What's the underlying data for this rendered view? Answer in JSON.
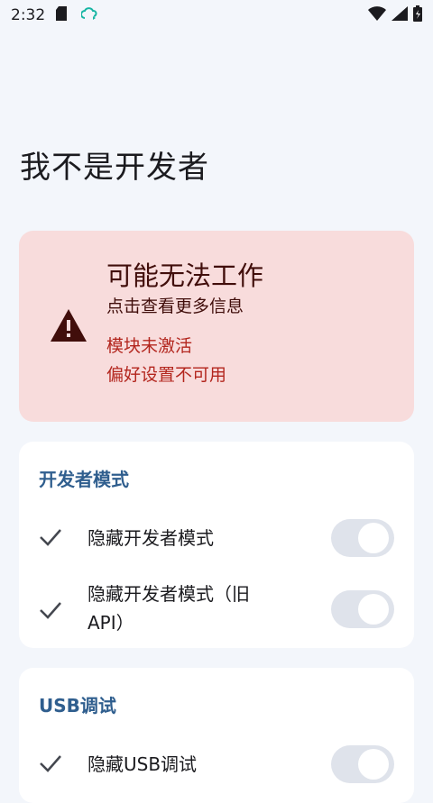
{
  "status_bar": {
    "time": "2:32",
    "icons": [
      "sd-card-icon",
      "cloud-sync-icon",
      "wifi-icon",
      "cell-signal-icon",
      "battery-icon"
    ]
  },
  "page": {
    "title": "我不是开发者"
  },
  "warning": {
    "icon": "warning-triangle-icon",
    "title": "可能无法工作",
    "subtitle": "点击查看更多信息",
    "reasons": [
      "模块未激活",
      "偏好设置不可用"
    ]
  },
  "sections": [
    {
      "title": "开发者模式",
      "items": [
        {
          "label": "隐藏开发者模式",
          "checked": true,
          "toggle_on": false
        },
        {
          "label_line1": "隐藏开发者模式（旧",
          "label_line2": "API）",
          "checked": true,
          "toggle_on": false
        }
      ]
    },
    {
      "title": "USB调试",
      "items": [
        {
          "label": "隐藏USB调试",
          "checked": true,
          "toggle_on": false
        }
      ]
    }
  ],
  "colors": {
    "background": "#f3f6fb",
    "warning_bg": "#f8dcdc",
    "warning_text": "#410e0b",
    "error_text": "#b3261e",
    "section_title": "#2f5e8e",
    "toggle_track": "#dfe3eb"
  }
}
